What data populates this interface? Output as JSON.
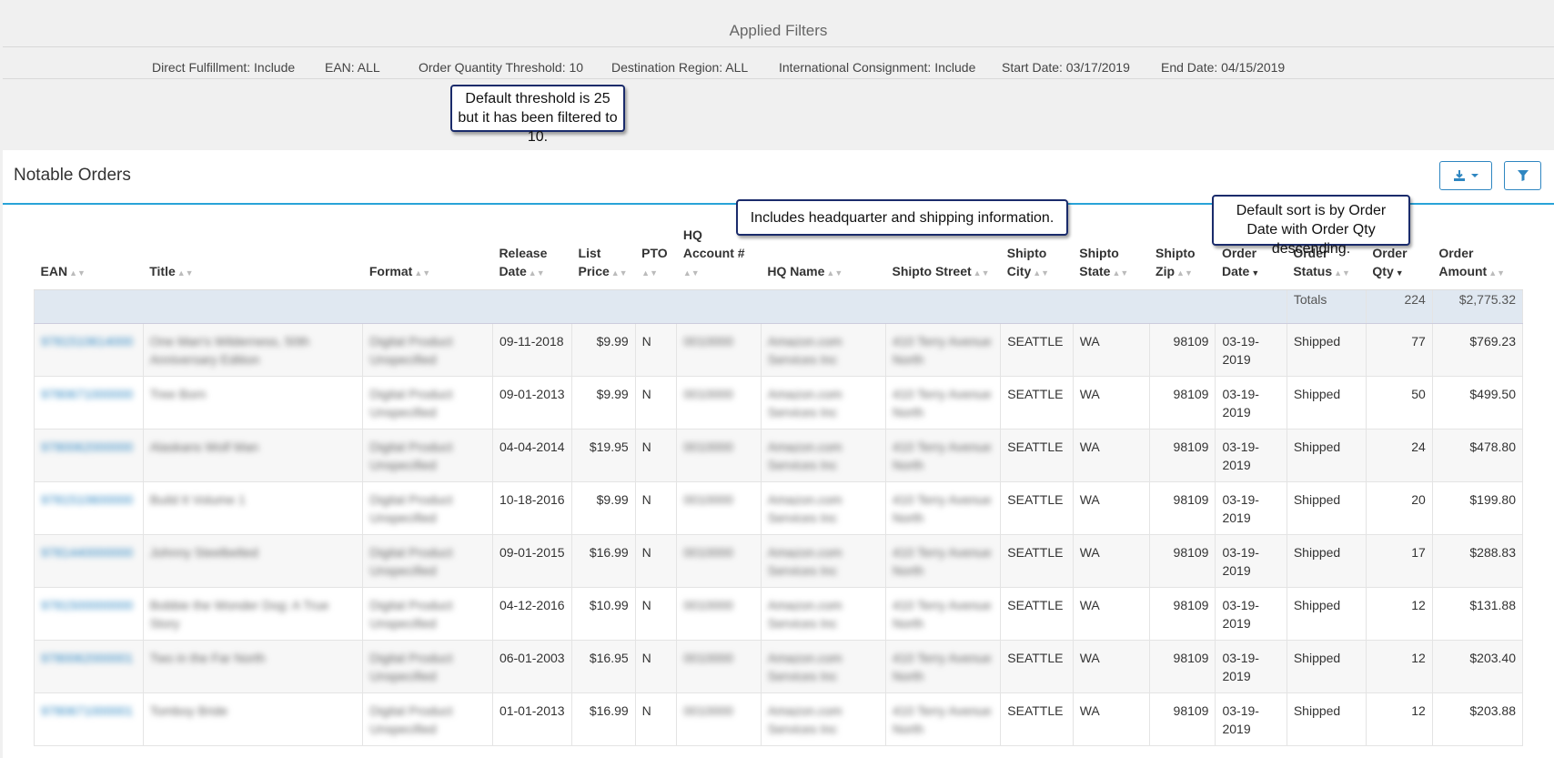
{
  "filters": {
    "title": "Applied Filters",
    "items": [
      {
        "label": "Direct Fulfillment: Include"
      },
      {
        "label": "EAN: ALL"
      },
      {
        "label": "Order Quantity Threshold: 10"
      },
      {
        "label": "Destination Region: ALL"
      },
      {
        "label": "International Consignment: Include"
      },
      {
        "label": "Start Date: 03/17/2019"
      },
      {
        "label": "End Date: 04/15/2019"
      }
    ]
  },
  "callouts": {
    "threshold": "Default threshold is 25 but it has been filtered to 10.",
    "hq_info": "Includes headquarter and shipping information.",
    "sort": "Default sort is by Order  Date with Order Qty descending."
  },
  "panel": {
    "title": "Notable Orders",
    "download_icon": "download-icon",
    "filter_icon": "filter-icon"
  },
  "table": {
    "columns": [
      "EAN",
      "Title",
      "Format",
      "Release Date",
      "List Price",
      "PTO",
      "HQ Account #",
      "HQ Name",
      "Shipto Street",
      "Shipto City",
      "Shipto State",
      "Shipto Zip",
      "Order Date",
      "Order Status",
      "Order Qty",
      "Order Amount"
    ],
    "sorted_column": "Order Date",
    "totals": {
      "label": "Totals",
      "qty": "224",
      "amount": "$2,775.32"
    },
    "rows": [
      {
        "ean": "9781510614000",
        "title": "One Man's Wilderness, 50th Anniversary Edition",
        "format": "Digital Product Unspecified",
        "release": "09-11-2018",
        "price": "$9.99",
        "pto": "N",
        "hq_acct": "0010000",
        "hq_name": "Amazon.com Services Inc",
        "street": "410 Terry Avenue North",
        "city": "SEATTLE",
        "state": "WA",
        "zip": "98109",
        "order_date": "03-19-2019",
        "status": "Shipped",
        "qty": "77",
        "amount": "$769.23"
      },
      {
        "ean": "9780671000000",
        "title": "Tree Born",
        "format": "Digital Product Unspecified",
        "release": "09-01-2013",
        "price": "$9.99",
        "pto": "N",
        "hq_acct": "0010000",
        "hq_name": "Amazon.com Services Inc",
        "street": "410 Terry Avenue North",
        "city": "SEATTLE",
        "state": "WA",
        "zip": "98109",
        "order_date": "03-19-2019",
        "status": "Shipped",
        "qty": "50",
        "amount": "$499.50"
      },
      {
        "ean": "9780062000000",
        "title": "Alaskans Wolf Man",
        "format": "Digital Product Unspecified",
        "release": "04-04-2014",
        "price": "$19.95",
        "pto": "N",
        "hq_acct": "0010000",
        "hq_name": "Amazon.com Services Inc",
        "street": "410 Terry Avenue North",
        "city": "SEATTLE",
        "state": "WA",
        "zip": "98109",
        "order_date": "03-19-2019",
        "status": "Shipped",
        "qty": "24",
        "amount": "$478.80"
      },
      {
        "ean": "9781510600000",
        "title": "Build It Volume 1",
        "format": "Digital Product Unspecified",
        "release": "10-18-2016",
        "price": "$9.99",
        "pto": "N",
        "hq_acct": "0010000",
        "hq_name": "Amazon.com Services Inc",
        "street": "410 Terry Avenue North",
        "city": "SEATTLE",
        "state": "WA",
        "zip": "98109",
        "order_date": "03-19-2019",
        "status": "Shipped",
        "qty": "20",
        "amount": "$199.80"
      },
      {
        "ean": "9781440000000",
        "title": "Johnny Steelbelted",
        "format": "Digital Product Unspecified",
        "release": "09-01-2015",
        "price": "$16.99",
        "pto": "N",
        "hq_acct": "0010000",
        "hq_name": "Amazon.com Services Inc",
        "street": "410 Terry Avenue North",
        "city": "SEATTLE",
        "state": "WA",
        "zip": "98109",
        "order_date": "03-19-2019",
        "status": "Shipped",
        "qty": "17",
        "amount": "$288.83"
      },
      {
        "ean": "9781500000000",
        "title": "Bobbie the Wonder Dog: A True Story",
        "format": "Digital Product Unspecified",
        "release": "04-12-2016",
        "price": "$10.99",
        "pto": "N",
        "hq_acct": "0010000",
        "hq_name": "Amazon.com Services Inc",
        "street": "410 Terry Avenue North",
        "city": "SEATTLE",
        "state": "WA",
        "zip": "98109",
        "order_date": "03-19-2019",
        "status": "Shipped",
        "qty": "12",
        "amount": "$131.88"
      },
      {
        "ean": "9780062000001",
        "title": "Two in the Far North",
        "format": "Digital Product Unspecified",
        "release": "06-01-2003",
        "price": "$16.95",
        "pto": "N",
        "hq_acct": "0010000",
        "hq_name": "Amazon.com Services Inc",
        "street": "410 Terry Avenue North",
        "city": "SEATTLE",
        "state": "WA",
        "zip": "98109",
        "order_date": "03-19-2019",
        "status": "Shipped",
        "qty": "12",
        "amount": "$203.40"
      },
      {
        "ean": "9780671000001",
        "title": "Tomboy Bride",
        "format": "Digital Product Unspecified",
        "release": "01-01-2013",
        "price": "$16.99",
        "pto": "N",
        "hq_acct": "0010000",
        "hq_name": "Amazon.com Services Inc",
        "street": "410 Terry Avenue North",
        "city": "SEATTLE",
        "state": "WA",
        "zip": "98109",
        "order_date": "03-19-2019",
        "status": "Shipped",
        "qty": "12",
        "amount": "$203.88"
      }
    ]
  }
}
